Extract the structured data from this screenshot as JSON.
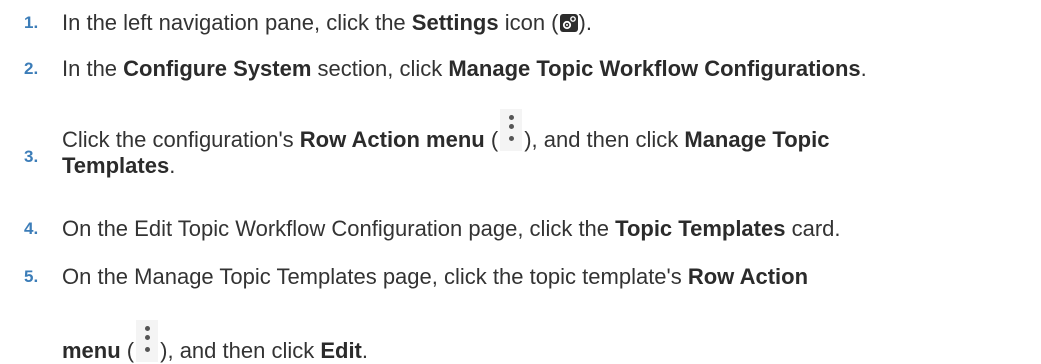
{
  "steps": [
    {
      "num": "1.",
      "parts": [
        "In the left navigation pane, click the ",
        "Settings",
        " icon (",
        ")."
      ]
    },
    {
      "num": "2.",
      "parts": [
        "In the ",
        "Configure System",
        " section, click ",
        "Manage Topic Workflow Configurations",
        "."
      ]
    },
    {
      "num": "3.",
      "parts": [
        "Click the configuration's ",
        "Row Action menu",
        " (",
        "), and then click ",
        "Manage Topic",
        "Templates",
        "."
      ]
    },
    {
      "num": "4.",
      "parts": [
        "On the Edit Topic Workflow Configuration page, click the ",
        "Topic Templates",
        " card."
      ]
    },
    {
      "num": "5.",
      "parts": [
        "On the Manage Topic Templates page, click the topic template's ",
        "Row Action",
        "menu",
        " (",
        "), and then click ",
        "Edit",
        "."
      ]
    }
  ],
  "icons": {
    "settings": "settings-gear-icon",
    "row_action": "vertical-ellipsis-icon"
  },
  "colors": {
    "step_number": "#3c7db8",
    "text": "#333333"
  }
}
